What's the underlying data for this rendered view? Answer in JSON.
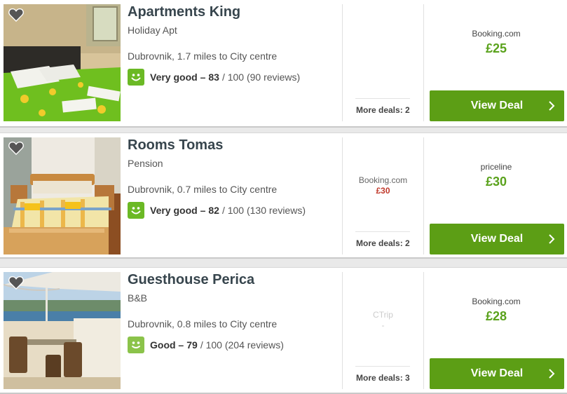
{
  "listings": [
    {
      "title": "Apartments King",
      "type": "Holiday Apt",
      "location": "Dubrovnik, 1.7 miles to City centre",
      "rating_label": "Very good –",
      "rating_score": "83",
      "rating_rest": "/ 100 (90 reviews)",
      "alt_site": "",
      "alt_price": "",
      "more_deals": "More deals: 2",
      "deal_site": "Booking.com",
      "deal_price": "£25",
      "button_label": "View Deal"
    },
    {
      "title": "Rooms Tomas",
      "type": "Pension",
      "location": "Dubrovnik, 0.7 miles to City centre",
      "rating_label": "Very good –",
      "rating_score": "82",
      "rating_rest": "/ 100 (130 reviews)",
      "alt_site": "Booking.com",
      "alt_price": "£30",
      "more_deals": "More deals: 2",
      "deal_site": "priceline",
      "deal_price": "£30",
      "button_label": "View Deal"
    },
    {
      "title": "Guesthouse Perica",
      "type": "B&B",
      "location": "Dubrovnik, 0.8 miles to City centre",
      "rating_label": "Good –",
      "rating_score": "79",
      "rating_rest": "/ 100 (204 reviews)",
      "alt_site": "CTrip",
      "alt_price": "-",
      "more_deals": "More deals: 3",
      "deal_site": "Booking.com",
      "deal_price": "£28",
      "button_label": "View Deal"
    }
  ],
  "colors": {
    "deal_button": "#5c9e15",
    "price_green": "#5aa21c",
    "rating_good": "#6bb925",
    "rating_ok": "#8bc34a",
    "alt_price_red": "#c0392b"
  },
  "icons": {
    "favorite": "heart-icon",
    "rating": "smiley-icon",
    "button_arrow": "chevron-right-icon"
  }
}
